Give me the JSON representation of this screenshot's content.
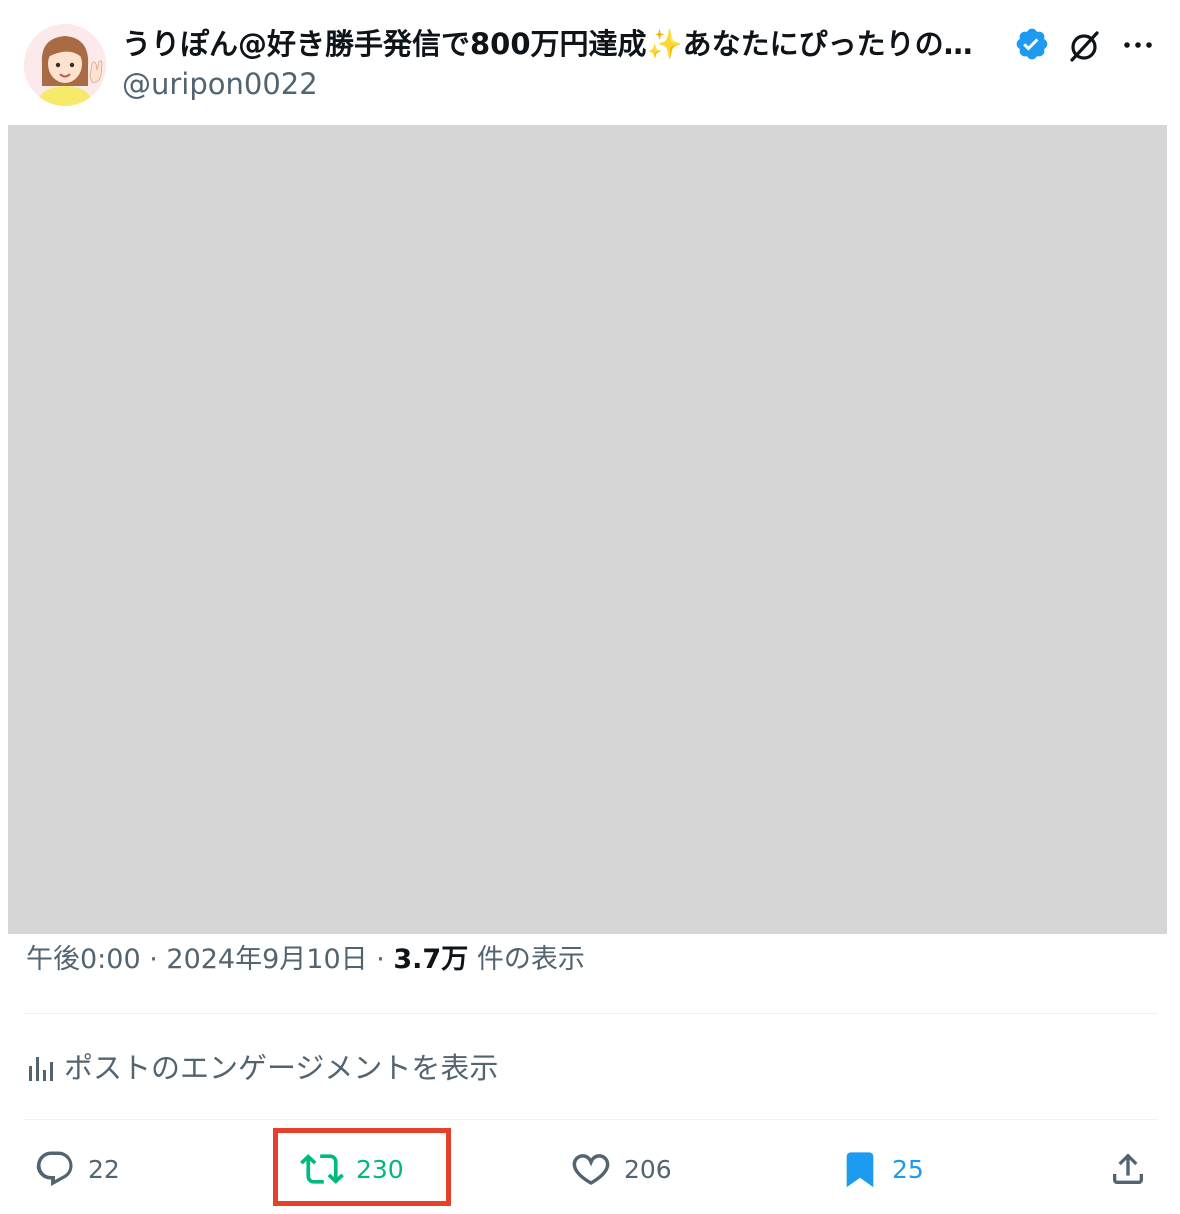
{
  "author": {
    "display_name": "うりぽん@好き勝手発信で800万円達成✨あなたにぴったりの…",
    "handle": "@uripon0022",
    "verified": true
  },
  "post": {
    "time": "午後0:00",
    "separator": " · ",
    "date": "2024年9月10日",
    "views_count": "3.7万",
    "views_label": " 件の表示"
  },
  "engagements_link": "ポストのエンゲージメントを表示",
  "actions": {
    "reply_count": "22",
    "retweet_count": "230",
    "like_count": "206",
    "bookmark_count": "25"
  },
  "colors": {
    "retweet": "#00ba7c",
    "bookmark": "#1d9bf0",
    "verified": "#1d9bf0",
    "highlight": "#e4402a",
    "muted_text": "#536471"
  },
  "icons": [
    "verified-badge-icon",
    "grok-icon",
    "more-icon",
    "analytics-icon",
    "reply-icon",
    "retweet-icon",
    "like-icon",
    "bookmark-icon",
    "share-icon"
  ]
}
